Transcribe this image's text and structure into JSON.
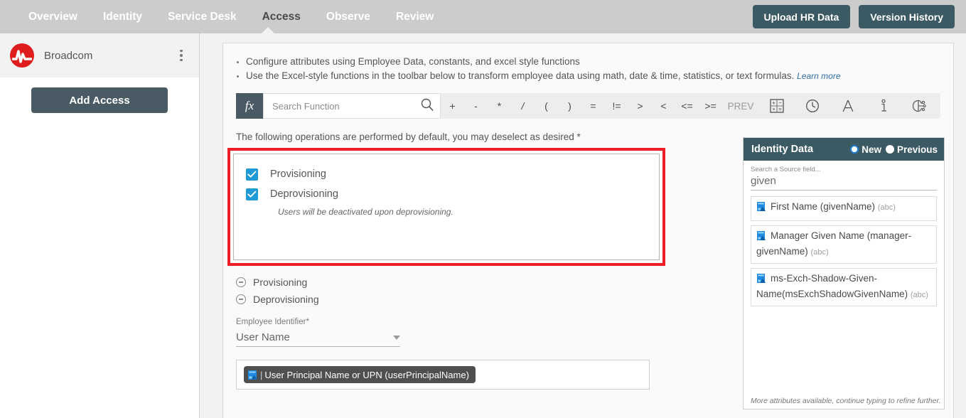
{
  "topnav": {
    "tabs": [
      {
        "label": "Overview",
        "active": false
      },
      {
        "label": "Identity",
        "active": false
      },
      {
        "label": "Service Desk",
        "active": false
      },
      {
        "label": "Access",
        "active": true
      },
      {
        "label": "Observe",
        "active": false
      },
      {
        "label": "Review",
        "active": false
      }
    ],
    "upload_button": "Upload HR Data",
    "version_button": "Version History",
    "accent_color": "#3c5a63",
    "bar_color": "#cccccc"
  },
  "sidebar": {
    "org_name": "Broadcom",
    "logo_icon": "broadcom-pulse-logo",
    "menu_icon": "kebab-menu-icon",
    "add_access_button": "Add Access",
    "brand_color": "#e01d1d"
  },
  "main": {
    "bullets": [
      "Configure attributes using Employee Data, constants, and excel style functions",
      "Use the Excel-style functions in the toolbar below to transform employee data using math, date & time, statistics, or text formulas."
    ],
    "learn_more": "Learn more",
    "toolbar": {
      "fx_label": "fx",
      "search_placeholder": "Search Function",
      "search_value": "",
      "search_icon": "search-icon",
      "operators": [
        "+",
        "-",
        "*",
        "/",
        "(",
        ")",
        "=",
        "!=",
        ">",
        "<",
        "<=",
        ">="
      ],
      "prev_label": "PREV",
      "icons": [
        "calculator-icon",
        "clock-icon",
        "text-a-icon",
        "info-i-icon",
        "ai-brain-icon"
      ]
    },
    "operations": {
      "instruction": "The following operations are performed by default, you may deselect as desired *",
      "highlight_color": "#ee1c25",
      "items": [
        {
          "label": "Provisioning",
          "checked": true
        },
        {
          "label": "Deprovisioning",
          "checked": true
        }
      ],
      "note": "Users will be deactivated upon deprovisioning."
    },
    "collapsibles": [
      {
        "label": "Provisioning",
        "icon": "circle-minus-icon"
      },
      {
        "label": "Deprovisioning",
        "icon": "circle-minus-icon"
      }
    ],
    "employee_identifier": {
      "label": "Employee Identifier*",
      "value": "User Name",
      "caret_icon": "chevron-down-icon"
    },
    "token_field": {
      "token_icon": "attribute-icon",
      "token_label": "User Principal Name or UPN (userPrincipalName)"
    }
  },
  "identity_panel": {
    "title": "Identity Data",
    "radios": [
      {
        "label": "New",
        "selected": true
      },
      {
        "label": "Previous",
        "selected": false
      }
    ],
    "search_label": "Search a Source field...",
    "search_value": "given",
    "attributes": [
      {
        "name": "First Name (givenName)",
        "type": "(abc)",
        "icon": "attribute-icon"
      },
      {
        "name": "Manager Given Name (manager-givenName)",
        "type": "(abc)",
        "icon": "attribute-icon"
      },
      {
        "name": "ms-Exch-Shadow-Given-Name(msExchShadowGivenName)",
        "type": "(abc)",
        "icon": "attribute-icon"
      }
    ],
    "footer_note": "More attributes available, continue typing to refine further.",
    "header_color": "#3c5a63"
  }
}
